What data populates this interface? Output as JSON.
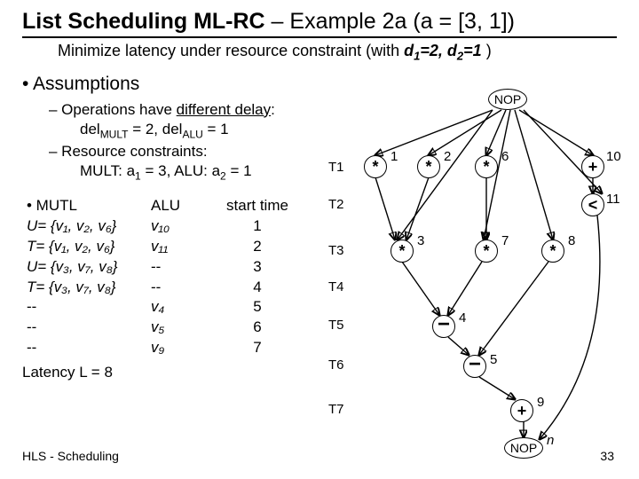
{
  "title_prefix": "List Scheduling ML-RC",
  "title_suffix": " – Example 2a (a = [3, 1])",
  "subtitle_a": "Minimize latency under resource constraint (with ",
  "subtitle_b": "d",
  "subtitle_c": "=2, d",
  "subtitle_d": "=1",
  "subtitle_e": " )",
  "assumptions_h": "•  Assumptions",
  "assume_1a": "– Operations have ",
  "assume_1b": "different delay",
  "assume_1c": ":",
  "assume_1_line2": "del",
  "assume_1_line2b": " = 2, del",
  "assume_1_line2c": " = 1",
  "assume_2": "– Resource constraints:",
  "assume_2_line2a": "MULT: a",
  "assume_2_line2b": " = 3, ALU: a",
  "assume_2_line2c": " = 1",
  "tbl_h1": "•      MUTL",
  "tbl_h2": "ALU",
  "tbl_h3": "start time",
  "rows": [
    {
      "c1": "U= {v₁, v₂, v₆}",
      "c2": "v₁₀",
      "c3": "1"
    },
    {
      "c1": "T= {v₁, v₂, v₆}",
      "c2": "v₁₁",
      "c3": "2"
    },
    {
      "c1": "U= {v₃, v₇, v₈}",
      "c2": "--",
      "c3": "3"
    },
    {
      "c1": "T= {v₃, v₇, v₈}",
      "c2": "--",
      "c3": "4"
    },
    {
      "c1": "           --",
      "c2": "v₄",
      "c3": "5"
    },
    {
      "c1": "           --",
      "c2": "v₅",
      "c3": "6"
    },
    {
      "c1": "           --",
      "c2": "v₉",
      "c3": "7"
    }
  ],
  "latency": "Latency L = 8",
  "footer_left": "HLS - Scheduling",
  "footer_right": "33",
  "tlabels": [
    "T1",
    "T2",
    "T3",
    "T4",
    "T5",
    "T6",
    "T7"
  ],
  "nop": "NOP",
  "nop2_suffix": "n",
  "node_ids": [
    "1",
    "2",
    "3",
    "4",
    "5",
    "6",
    "7",
    "8",
    "9",
    "10",
    "11"
  ],
  "ops": {
    "mul": "*",
    "add": "+",
    "sub": "−",
    "lt": "<"
  },
  "chart_data": {
    "type": "dag",
    "description": "Scheduling DAG with NOP source/sink, timesteps T1..T7",
    "nodes": [
      {
        "id": "NOP_top",
        "op": "nop"
      },
      {
        "id": 1,
        "op": "*",
        "t": 1
      },
      {
        "id": 2,
        "op": "*",
        "t": 1
      },
      {
        "id": 6,
        "op": "*",
        "t": 1
      },
      {
        "id": 10,
        "op": "+",
        "t": 1
      },
      {
        "id": 11,
        "op": "<",
        "t": 2
      },
      {
        "id": 3,
        "op": "*",
        "t": 3
      },
      {
        "id": 7,
        "op": "*",
        "t": 3
      },
      {
        "id": 8,
        "op": "*",
        "t": 3
      },
      {
        "id": 4,
        "op": "-",
        "t": 5
      },
      {
        "id": 5,
        "op": "-",
        "t": 6
      },
      {
        "id": 9,
        "op": "+",
        "t": 7
      },
      {
        "id": "NOP_bot",
        "op": "nop"
      }
    ],
    "edges": [
      [
        "NOP_top",
        1
      ],
      [
        "NOP_top",
        2
      ],
      [
        "NOP_top",
        6
      ],
      [
        "NOP_top",
        10
      ],
      [
        "NOP_top",
        8
      ],
      [
        "NOP_top",
        11
      ],
      [
        "NOP_top",
        7
      ],
      [
        "NOP_top",
        3
      ],
      [
        1,
        3
      ],
      [
        2,
        3
      ],
      [
        6,
        7
      ],
      [
        10,
        11
      ],
      [
        3,
        4
      ],
      [
        7,
        4
      ],
      [
        4,
        5
      ],
      [
        8,
        5
      ],
      [
        5,
        9
      ],
      [
        9,
        "NOP_bot"
      ],
      [
        11,
        "NOP_bot"
      ]
    ]
  }
}
